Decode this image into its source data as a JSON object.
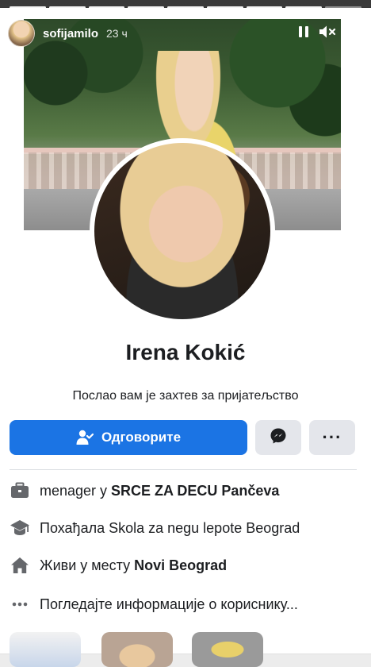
{
  "story": {
    "username": "sofijamilo",
    "time_ago": "23 ч"
  },
  "profile": {
    "name": "Irena Kokić",
    "request_text": "Послао вам је захтев за пријатељство",
    "respond_label": "Одговорите"
  },
  "info": {
    "work_prefix": "menager у ",
    "work_place": "SRCE ZA DECU Pančeva",
    "school": "Похађала Skola za negu lepote Beograd",
    "lives_prefix": "Живи у месту ",
    "lives_place": "Novi Beograd",
    "see_more": "Погледајте информације о кориснику..."
  },
  "colors": {
    "primary_button": "#1b74e4",
    "secondary_button": "#e4e6eb"
  },
  "icons": {
    "briefcase": "briefcase-icon",
    "school": "graduation-cap-icon",
    "home": "home-icon",
    "more": "ellipsis-icon",
    "messenger": "messenger-icon",
    "add_person": "person-respond-icon"
  }
}
